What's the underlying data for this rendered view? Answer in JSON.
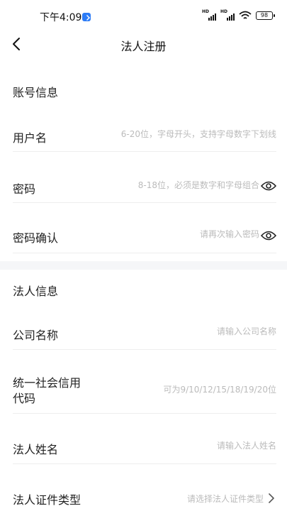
{
  "status_bar": {
    "time": "下午4:09",
    "signal_1": "HD",
    "signal_2": "HD",
    "battery": "98"
  },
  "nav": {
    "title": "法人注册"
  },
  "account_section": {
    "title": "账号信息",
    "username": {
      "label": "用户名",
      "placeholder": "6-20位，字母开头，支持字母数字下划线"
    },
    "password": {
      "label": "密码",
      "placeholder": "8-18位，必须是数字和字母组合"
    },
    "password_confirm": {
      "label": "密码确认",
      "placeholder": "请再次输入密码"
    }
  },
  "legal_section": {
    "title": "法人信息",
    "company_name": {
      "label": "公司名称",
      "placeholder": "请输入公司名称"
    },
    "credit_code": {
      "label_line1": "统一社会信用",
      "label_line2": "代码",
      "placeholder": "可为9/10/12/15/18/19/20位"
    },
    "legal_name": {
      "label": "法人姓名",
      "placeholder": "请输入法人姓名"
    },
    "id_type": {
      "label": "法人证件类型",
      "placeholder": "请选择法人证件类型"
    }
  }
}
